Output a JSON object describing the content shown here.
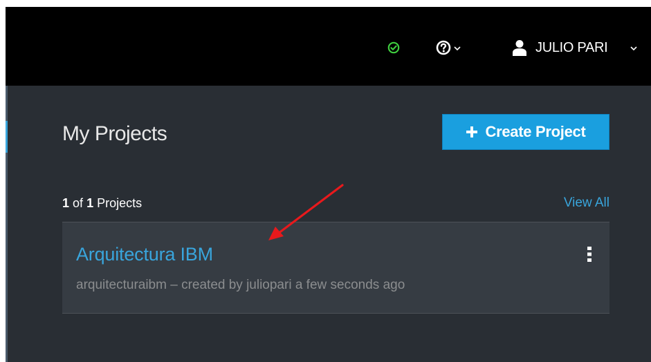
{
  "header": {
    "user_name": "JULIO PARI",
    "status_icon": "check-circle-icon",
    "help_icon": "question-circle-icon",
    "user_icon": "user-icon"
  },
  "main": {
    "title": "My Projects",
    "create_button_label": "Create Project",
    "count_current": "1",
    "count_of": "of",
    "count_total": "1",
    "count_suffix": "Projects",
    "view_all_label": "View All"
  },
  "projects": [
    {
      "name": "Arquitectura IBM",
      "meta": "arquitecturaibm – created by juliopari a few seconds ago"
    }
  ],
  "colors": {
    "topbar": "#000000",
    "panel": "#292e34",
    "card": "#363c43",
    "accent": "#1a9fdf",
    "link": "#39a5dc",
    "status_ok": "#3fcd3f",
    "annotation": "#e8191c"
  }
}
